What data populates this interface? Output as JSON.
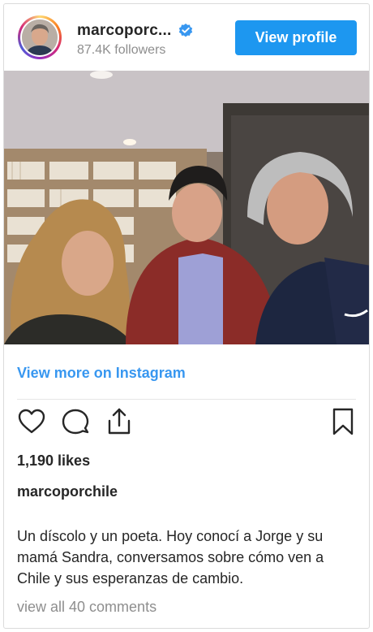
{
  "header": {
    "username": "marcoporc...",
    "followers": "87.4K followers",
    "view_profile_label": "View profile",
    "verified_icon": "verified-badge-icon"
  },
  "post": {
    "view_more_label": "View more on Instagram",
    "likes": "1,190 likes",
    "caption_username": "marcoporchile",
    "caption_text": "Un díscolo y un poeta. Hoy conocí a Jorge y su mamá Sandra, conversamos sobre cómo ven a Chile y sus esperanzas de cambio.",
    "comments_link": "view all 40 comments"
  },
  "actions": {
    "icons": [
      "heart-icon",
      "comment-icon",
      "share-icon",
      "bookmark-icon"
    ]
  },
  "colors": {
    "accent": "#3897f0",
    "button": "#1d97f0",
    "muted": "#8e8e8e",
    "text": "#262626"
  }
}
